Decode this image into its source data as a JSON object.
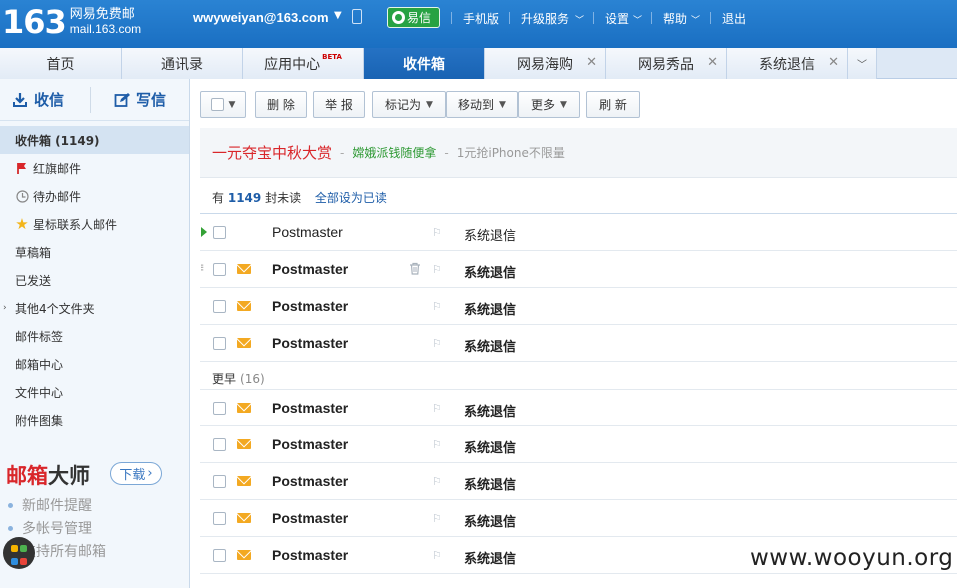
{
  "header": {
    "logo_number": "163",
    "logo_title": "网易免费邮",
    "logo_domain": "mail.163.com",
    "user": "wwyweiyan@163.com",
    "yixin": "易信",
    "links": [
      "手机版",
      "升级服务",
      "设置",
      "帮助",
      "退出"
    ],
    "bg_color": "#1a6fc2"
  },
  "tabs": [
    {
      "label": "首页"
    },
    {
      "label": "通讯录"
    },
    {
      "label": "应用中心",
      "badge": "BETA"
    },
    {
      "label": "收件箱",
      "active": true
    },
    {
      "label": "网易海购",
      "closable": true
    },
    {
      "label": "网易秀品",
      "closable": true
    },
    {
      "label": "系统退信",
      "closable": true
    }
  ],
  "sidebar": {
    "receive": "收信",
    "compose": "写信",
    "items": [
      {
        "label": "收件箱 (1149)",
        "active": true
      },
      {
        "label": "红旗邮件",
        "icon": "red-flag-icon"
      },
      {
        "label": "待办邮件",
        "icon": "clock-icon"
      },
      {
        "label": "星标联系人邮件",
        "icon": "star-icon"
      },
      {
        "label": "草稿箱"
      },
      {
        "label": "已发送"
      },
      {
        "label": "其他4个文件夹",
        "expandable": true
      },
      {
        "label": "邮件标签"
      },
      {
        "label": "邮箱中心"
      },
      {
        "label": "文件中心"
      },
      {
        "label": "附件图集"
      }
    ],
    "promo": {
      "title_red": "邮箱",
      "title_dark": "大师",
      "download": "下载",
      "features": [
        "新邮件提醒",
        "多帐号管理",
        "支持所有邮箱"
      ]
    }
  },
  "toolbar": {
    "delete": "删 除",
    "report": "举 报",
    "mark": "标记为",
    "move": "移动到",
    "more": "更多",
    "refresh": "刷 新"
  },
  "banner": {
    "main": "一元夺宝中秋大赏",
    "sep1": "-",
    "green": "嫦娥派钱随便拿",
    "sep2": "-",
    "grey": "1元抢iPhone不限量"
  },
  "summary": {
    "prefix": "有",
    "count": "1149",
    "suffix": "封未读",
    "mark_all": "全部设为已读"
  },
  "group_earlier": {
    "label": "更早",
    "count": "(16)"
  },
  "mails": [
    {
      "sender": "Postmaster",
      "subject": "系统退信",
      "unread": false
    },
    {
      "sender": "Postmaster",
      "subject": "系统退信",
      "unread": true
    },
    {
      "sender": "Postmaster",
      "subject": "系统退信",
      "unread": true
    },
    {
      "sender": "Postmaster",
      "subject": "系统退信",
      "unread": true
    },
    {
      "sender": "Postmaster",
      "subject": "系统退信",
      "unread": true
    },
    {
      "sender": "Postmaster",
      "subject": "系统退信",
      "unread": true
    },
    {
      "sender": "Postmaster",
      "subject": "系统退信",
      "unread": true
    },
    {
      "sender": "Postmaster",
      "subject": "系统退信",
      "unread": true
    },
    {
      "sender": "Postmaster",
      "subject": "系统退信",
      "unread": true
    }
  ],
  "watermark": "www.wooyun.org"
}
